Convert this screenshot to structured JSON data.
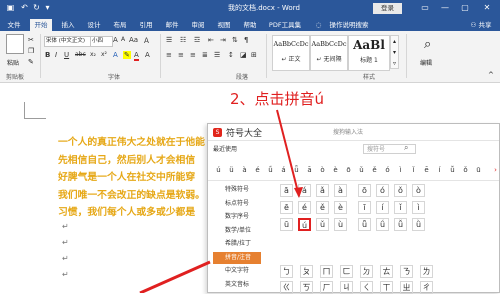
{
  "titlebar": {
    "doc_title": "我的文档.docx - Word",
    "login": "登录",
    "buttons": [
      "▭",
      "—",
      "▢",
      "✕"
    ]
  },
  "tabs": [
    {
      "label": "文件",
      "active": false
    },
    {
      "label": "开始",
      "active": true
    },
    {
      "label": "插入",
      "active": false
    },
    {
      "label": "设计",
      "active": false
    },
    {
      "label": "布局",
      "active": false
    },
    {
      "label": "引用",
      "active": false
    },
    {
      "label": "邮件",
      "active": false
    },
    {
      "label": "审阅",
      "active": false
    },
    {
      "label": "视图",
      "active": false
    },
    {
      "label": "帮助",
      "active": false
    },
    {
      "label": "PDF工具集",
      "active": false
    },
    {
      "label": "操作说明搜索",
      "active": false
    }
  ],
  "share": "共享",
  "ribbon": {
    "paste": "粘贴",
    "font_name": "宋体 (中文正文)",
    "font_size": "小四",
    "font_buttons": [
      "B",
      "I",
      "U",
      "abc",
      "x₂",
      "x²",
      "A",
      "A"
    ],
    "styles": [
      {
        "sample": "AaBbCcDc",
        "name": "正文"
      },
      {
        "sample": "AaBbCcDc",
        "name": "无间隔"
      },
      {
        "sample": "AaBl",
        "name": "标题 1"
      }
    ],
    "editing": "编辑",
    "groups": {
      "clipboard": "剪贴板",
      "font": "字体",
      "paragraph": "段落",
      "styles": "样式"
    }
  },
  "document": {
    "lines": [
      "一个人的真正伟大之处就在于他能",
      "先相信自己，然后别人才会相信",
      "好脾气是一个人在社交中所能穿",
      "我们唯一不会改正的缺点是软弱。",
      "习惯，我们每个人或多或少都是"
    ],
    "return_mark": "↵",
    "annotation": "2、点击拼音ú"
  },
  "symbol_dialog": {
    "title": "符号大全",
    "search_hint": "搜狗输入法",
    "recent_label": "最近使用",
    "search_placeholder": "搜符号",
    "recent": [
      "ú",
      "ü",
      "à",
      "é",
      "ǘ",
      "á",
      "ǖ",
      "ā",
      "ò",
      "è",
      "ō",
      "ǔ",
      "ě",
      "ó",
      "ì",
      "ǐ",
      "ē",
      "í",
      "ǚ",
      "ǒ",
      "ū"
    ],
    "categories": [
      {
        "label": "特殊符号",
        "active": false
      },
      {
        "label": "标点符号",
        "active": false
      },
      {
        "label": "数字序号",
        "active": false
      },
      {
        "label": "数学/单位",
        "active": false
      },
      {
        "label": "希腊/拉丁",
        "active": false
      },
      {
        "label": "拼音/注音",
        "active": true
      },
      {
        "label": "中文字符",
        "active": false
      },
      {
        "label": "英文音标",
        "active": false
      }
    ],
    "grid": [
      [
        "ā",
        "á",
        "ǎ",
        "à",
        "ō",
        "ó",
        "ǒ",
        "ò"
      ],
      [
        "ē",
        "é",
        "ě",
        "è",
        "ī",
        "í",
        "ǐ",
        "ì"
      ],
      [
        "ū",
        "ú",
        "ǔ",
        "ù",
        "ǖ",
        "ǘ",
        "ǚ",
        "ǜ"
      ]
    ],
    "zhuyin": [
      "ㄅ",
      "ㄆ",
      "ㄇ",
      "ㄈ",
      "ㄉ",
      "ㄊ",
      "ㄋ",
      "ㄌ",
      "ㄍ",
      "ㄎ",
      "ㄏ",
      "ㄐ",
      "ㄑ",
      "ㄒ",
      "ㄓ",
      "ㄔ"
    ]
  }
}
